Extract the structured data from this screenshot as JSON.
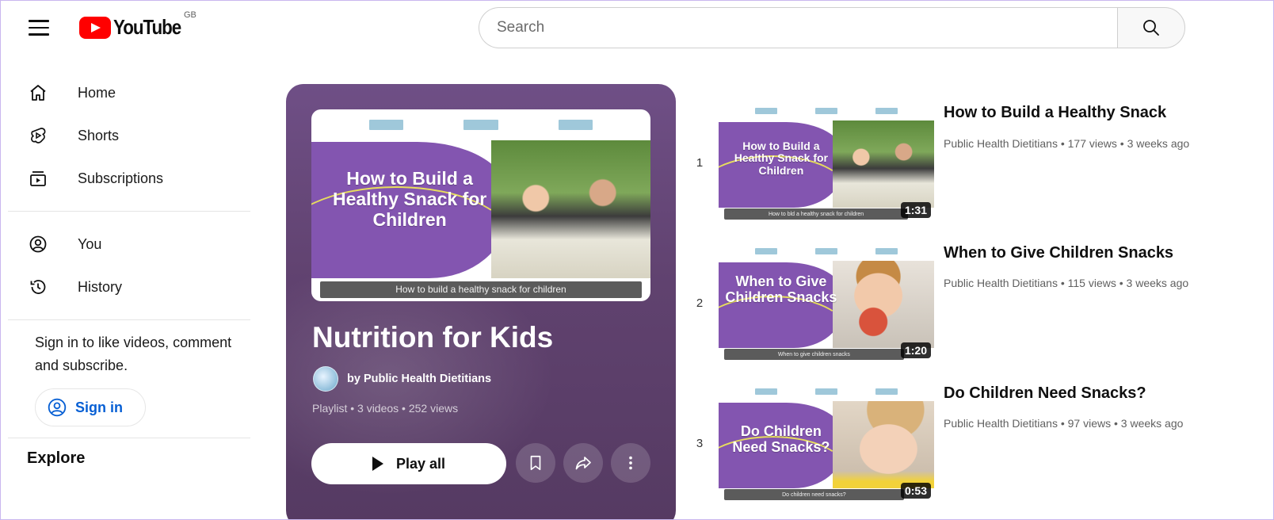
{
  "header": {
    "logo_text": "YouTube",
    "region": "GB",
    "search_placeholder": "Search"
  },
  "sidebar": {
    "items": [
      {
        "label": "Home",
        "icon": "home-icon"
      },
      {
        "label": "Shorts",
        "icon": "shorts-icon"
      },
      {
        "label": "Subscriptions",
        "icon": "subscriptions-icon"
      },
      {
        "label": "You",
        "icon": "you-icon"
      },
      {
        "label": "History",
        "icon": "history-icon"
      }
    ],
    "signin_prompt": "Sign in to like videos, comment and subscribe.",
    "signin_button": "Sign in",
    "explore_heading": "Explore"
  },
  "playlist": {
    "title": "Nutrition for Kids",
    "owner": "by Public Health Dietitians",
    "meta": "Playlist • 3 videos • 252 views",
    "play_all_label": "Play all",
    "thumb_text": "How to Build a Healthy Snack for Children",
    "thumb_caption": "How to build a healthy snack for children",
    "accent_color": "#6f4f86"
  },
  "videos": [
    {
      "index": "1",
      "title": "How to Build a Healthy Snack",
      "meta": "Public Health Dietitians • 177 views • 3 weeks ago",
      "duration": "1:31",
      "thumb_text": "How to Build a Healthy Snack for Children",
      "caption": "How to bld a healthy snack for children"
    },
    {
      "index": "2",
      "title": "When to Give Children Snacks",
      "meta": "Public Health Dietitians • 115 views • 3 weeks ago",
      "duration": "1:20",
      "thumb_text": "When to Give Children Snacks",
      "caption": "When to give children snacks"
    },
    {
      "index": "3",
      "title": "Do Children Need Snacks?",
      "meta": "Public Health Dietitians • 97 views • 3 weeks ago",
      "duration": "0:53",
      "thumb_text": "Do Children Need Snacks?",
      "caption": "Do children need snacks?"
    }
  ]
}
